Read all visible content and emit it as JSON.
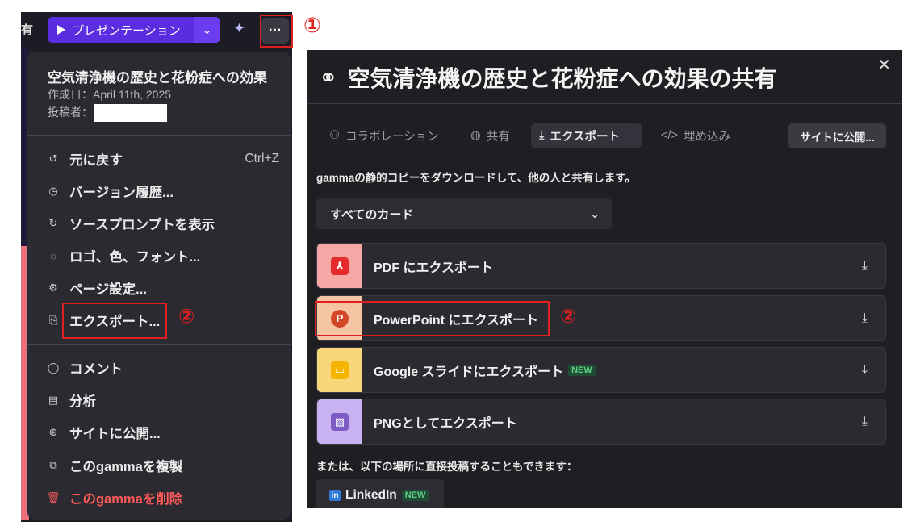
{
  "topbar": {
    "cut_text": "有",
    "present_label": "プレゼンテーション",
    "caret": "⌄",
    "sparkle": "✦",
    "more": "···"
  },
  "callouts": {
    "one": "①",
    "two": "②"
  },
  "menu": {
    "title": "空気清浄機の歴史と花粉症への効果",
    "created": "作成日：April 11th, 2025",
    "author_label": "投稿者：",
    "items": [
      {
        "label": "元に戻す",
        "icon": "↺",
        "shortcut": "Ctrl+Z"
      },
      {
        "label": "バージョン履歴...",
        "icon": "◷"
      },
      {
        "label": "ソースプロンプトを表示",
        "icon": "↻"
      },
      {
        "label": "ロゴ、色、フォント...",
        "icon": "◌"
      },
      {
        "label": "ページ設定...",
        "icon": "⚙"
      },
      {
        "label": "エクスポート...",
        "icon": "⎘"
      },
      {
        "label": "コメント",
        "icon": "◯"
      },
      {
        "label": "分析",
        "icon": "▤"
      },
      {
        "label": "サイトに公開...",
        "icon": "⊕"
      },
      {
        "label": "このgammaを複製",
        "icon": "⧉"
      },
      {
        "label": "このgammaを削除",
        "icon": "🗑"
      }
    ]
  },
  "dialog": {
    "title": "空気清浄機の歴史と花粉症への効果の共有",
    "link_icon": "⚭",
    "close": "✕",
    "tabs": [
      {
        "label": "コラボレーション",
        "icon": "⚇"
      },
      {
        "label": "共有",
        "icon": "◍"
      },
      {
        "label": "エクスポート",
        "icon": "⤓"
      },
      {
        "label": "埋め込み",
        "icon": "</>"
      }
    ],
    "publish_button": "サイトに公開...",
    "description": "gammaの静的コピーをダウンロードして、他の人と共有します。",
    "dropdown_value": "すべてのカード",
    "dropdown_caret": "⌄",
    "exports": [
      {
        "label": "PDF にエクスポート",
        "icon": "⅄",
        "badge": ""
      },
      {
        "label": "PowerPoint にエクスポート",
        "icon": "P",
        "badge": ""
      },
      {
        "label": "Google スライドにエクスポート",
        "icon": "▭",
        "badge": "NEW"
      },
      {
        "label": "PNGとしてエクスポート",
        "icon": "▨",
        "badge": ""
      }
    ],
    "download_icon": "⤓",
    "also_text": "または、以下の場所に直接投稿することもできます：",
    "linkedin": {
      "label": "LinkedIn",
      "icon": "in",
      "badge": "NEW"
    }
  },
  "colors": {
    "accent": "#5a2ee0",
    "pdf_bg": "#f7a6a6",
    "ppt_bg": "#f6c5a3",
    "gslides_bg": "#f7d77a",
    "png_bg": "#c9b2f2",
    "annotation_red": "#e02020"
  }
}
